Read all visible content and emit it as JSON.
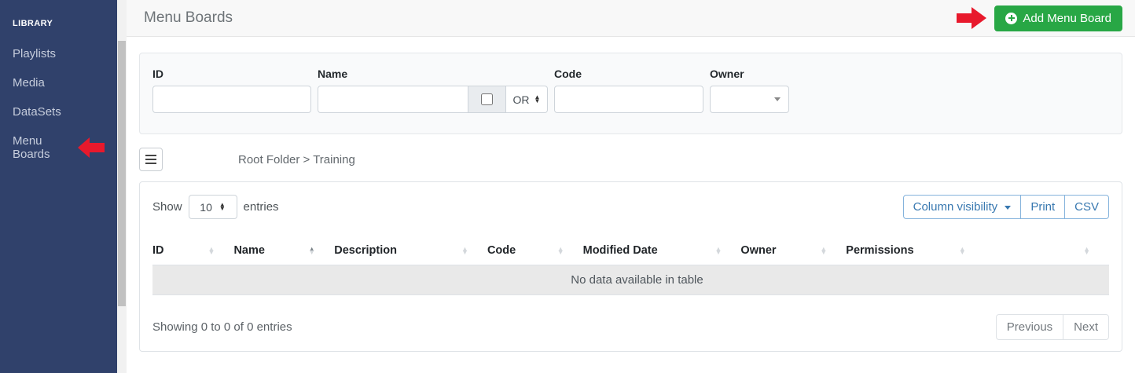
{
  "sidebar": {
    "section_label": "LIBRARY",
    "items": [
      {
        "label": "Playlists"
      },
      {
        "label": "Media"
      },
      {
        "label": "DataSets"
      },
      {
        "label": "Menu Boards",
        "active": true
      }
    ]
  },
  "header": {
    "title": "Menu Boards",
    "add_button_label": "Add Menu Board"
  },
  "filters": {
    "id_label": "ID",
    "id_value": "",
    "name_label": "Name",
    "name_value": "",
    "logic_operator": "OR",
    "code_label": "Code",
    "code_value": "",
    "owner_label": "Owner",
    "owner_value": ""
  },
  "folder_bar": {
    "breadcrumb": "Root Folder > Training"
  },
  "table": {
    "show_label": "Show",
    "page_length": "10",
    "entries_label": "entries",
    "buttons": {
      "column_visibility": "Column visibility",
      "print": "Print",
      "csv": "CSV"
    },
    "columns": [
      "ID",
      "Name",
      "Description",
      "Code",
      "Modified Date",
      "Owner",
      "Permissions",
      ""
    ],
    "sorted_column": "Name",
    "empty_message": "No data available in table",
    "summary": "Showing 0 to 0 of 0 entries",
    "pagination": {
      "previous": "Previous",
      "next": "Next"
    }
  },
  "colors": {
    "sidebar_bg": "#30416b",
    "success_green": "#28a745",
    "annotation_red": "#e8192c",
    "dt_button_blue": "#3878b0"
  }
}
